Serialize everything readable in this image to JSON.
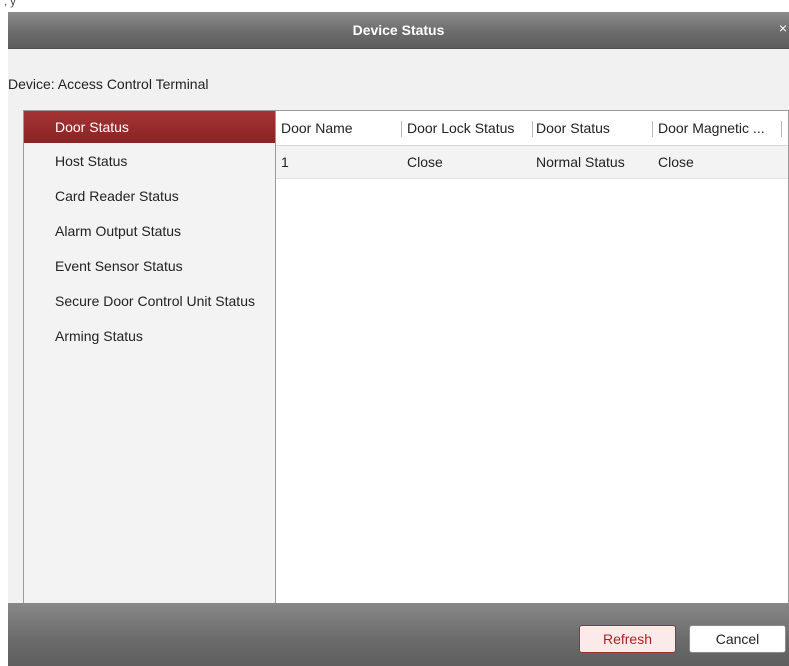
{
  "corner_mark": "', y",
  "dialog": {
    "title": "Device Status",
    "close_glyph": "×",
    "device_line": "Device: Access Control Terminal"
  },
  "sidebar": {
    "items": [
      {
        "label": "Door Status",
        "active": true
      },
      {
        "label": "Host Status",
        "active": false
      },
      {
        "label": "Card Reader Status",
        "active": false
      },
      {
        "label": "Alarm Output Status",
        "active": false
      },
      {
        "label": "Event Sensor Status",
        "active": false
      },
      {
        "label": "Secure Door Control Unit Status",
        "active": false
      },
      {
        "label": "Arming Status",
        "active": false
      }
    ]
  },
  "table": {
    "columns": [
      "Door Name",
      "Door Lock Status",
      "Door Status",
      "Door Magnetic ..."
    ],
    "rows": [
      [
        "1",
        "Close",
        "Normal Status",
        "Close"
      ]
    ]
  },
  "footer": {
    "refresh_label": "Refresh",
    "cancel_label": "Cancel"
  },
  "colors": {
    "active_item": "#9a2a2a",
    "titlebar": "#7a7a7a",
    "refresh_text": "#b02020"
  }
}
